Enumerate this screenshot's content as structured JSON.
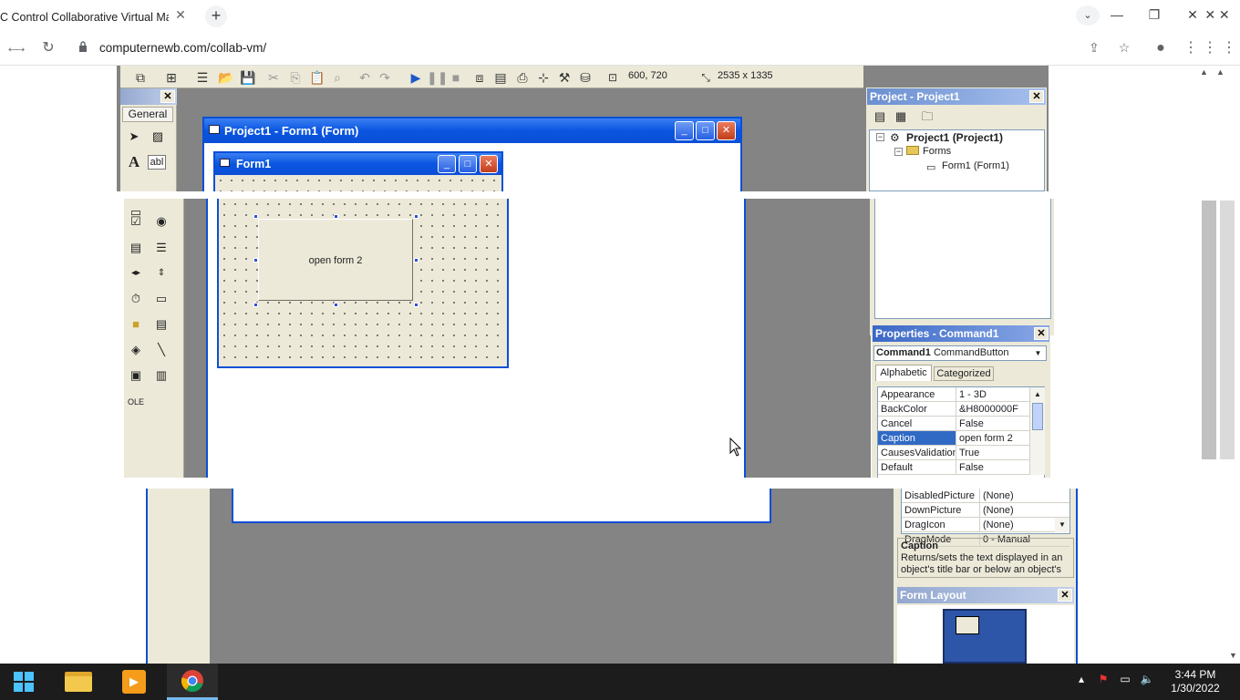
{
  "browser": {
    "tab_title": "C Control Collaborative Virtual Ma",
    "tab_close": "✕",
    "new_tab": "+",
    "url": "computernewb.com/collab-vm/",
    "window_controls": {
      "minimize": "—",
      "restore": "❐",
      "close": "✕"
    }
  },
  "vb": {
    "toolbar": {
      "position_readout": "600, 720",
      "size_readout": "2535 x 1335"
    },
    "toolbox": {
      "tab_label": "General"
    },
    "form_designer": {
      "title": "Project1 - Form1 (Form)"
    },
    "form1": {
      "title": "Form1",
      "button_caption": "open form 2"
    },
    "project_explorer": {
      "title": "Project - Project1",
      "root": "Project1 (Project1)",
      "folder": "Forms",
      "item": "Form1 (Form1)"
    },
    "properties": {
      "title": "Properties - Command1",
      "object_name": "Command1",
      "object_type": "CommandButton",
      "tab_alphabetic": "Alphabetic",
      "tab_categorized": "Categorized",
      "rows": [
        {
          "name": "Appearance",
          "value": "1 - 3D"
        },
        {
          "name": "BackColor",
          "value": "&H8000000F"
        },
        {
          "name": "Cancel",
          "value": "False"
        },
        {
          "name": "Caption",
          "value": "open form 2"
        },
        {
          "name": "CausesValidation",
          "value": "True"
        },
        {
          "name": "Default",
          "value": "False"
        }
      ],
      "rows_lower": [
        {
          "name": "DisabledPicture",
          "value": "(None)"
        },
        {
          "name": "DownPicture",
          "value": "(None)"
        },
        {
          "name": "DragIcon",
          "value": "(None)"
        },
        {
          "name": "DragMode",
          "value": "0 - Manual"
        }
      ],
      "desc_title": "Caption",
      "desc_text": "Returns/sets the text displayed in an object's title bar or below an object's"
    },
    "form_layout": {
      "title": "Form Layout"
    }
  },
  "taskbar": {
    "time": "3:44 PM",
    "date": "1/30/2022"
  }
}
